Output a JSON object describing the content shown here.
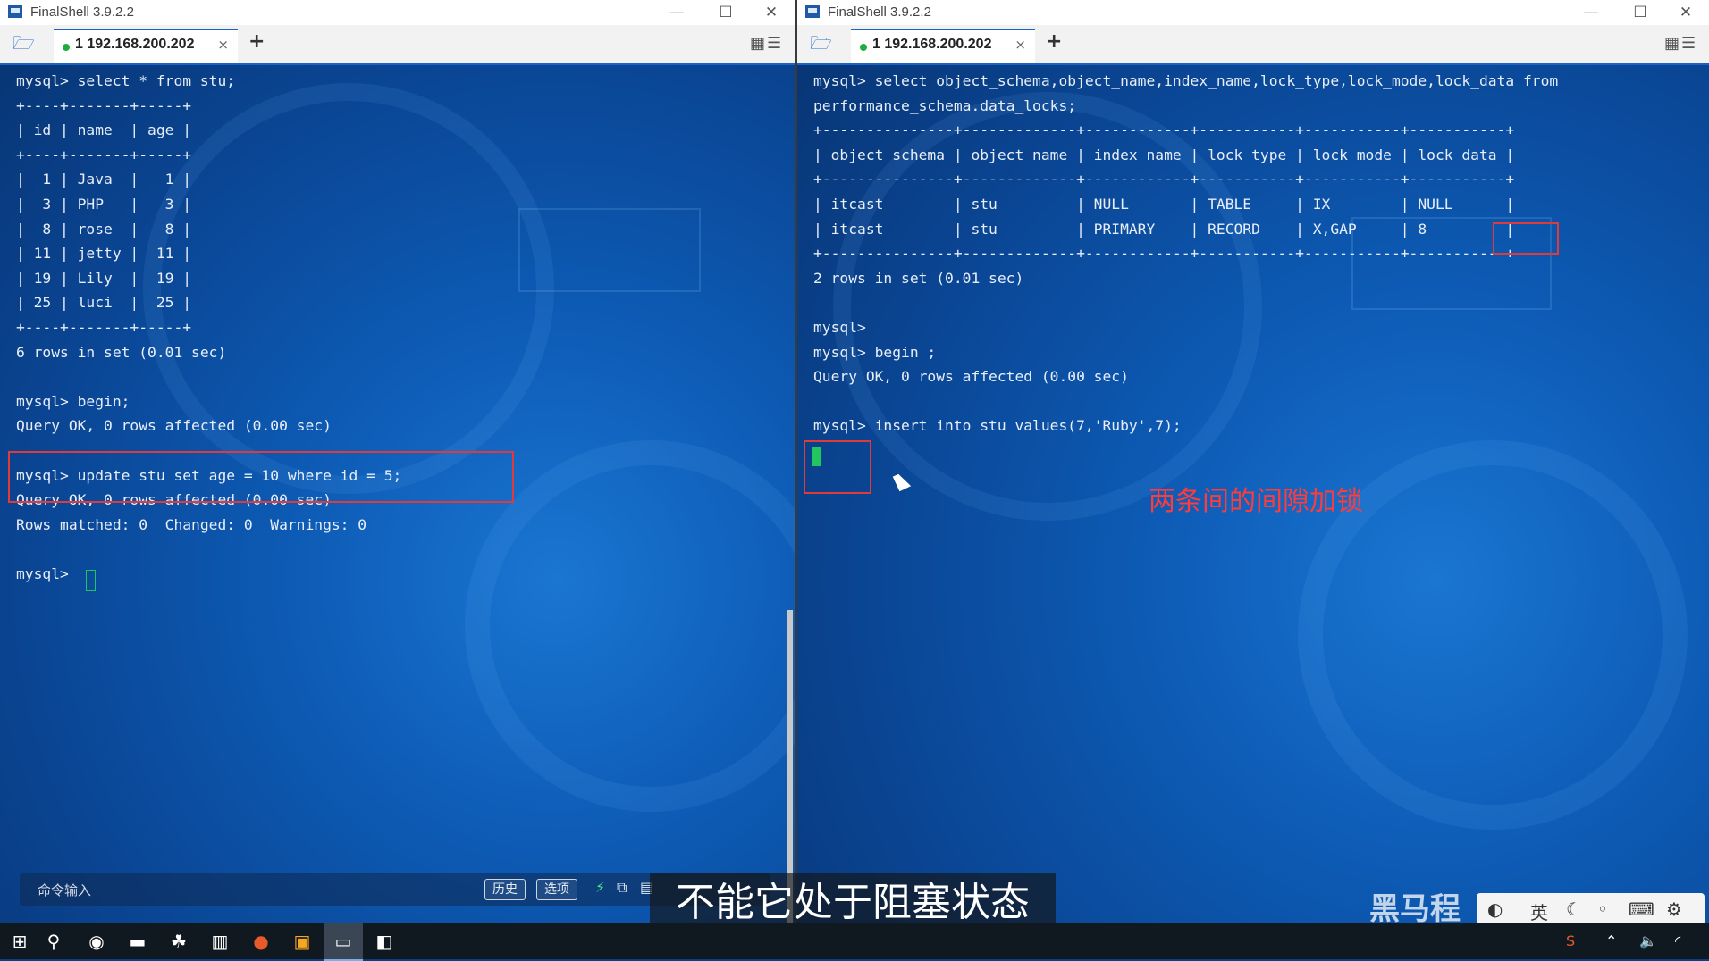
{
  "left": {
    "title": "FinalShell 3.9.2.2",
    "tab_label": "1 192.168.200.202",
    "tab_close": "×",
    "add_tab": "+",
    "terminal_lines": [
      "mysql> select * from stu;",
      "+----+-------+-----+",
      "| id | name  | age |",
      "+----+-------+-----+",
      "|  1 | Java  |   1 |",
      "|  3 | PHP   |   3 |",
      "|  8 | rose  |   8 |",
      "| 11 | jetty |  11 |",
      "| 19 | Lily  |  19 |",
      "| 25 | luci  |  25 |",
      "+----+-------+-----+",
      "6 rows in set (0.01 sec)",
      "",
      "mysql> begin;",
      "Query OK, 0 rows affected (0.00 sec)",
      "",
      "mysql> update stu set age = 10 where id = 5;",
      "Query OK, 0 rows affected (0.00 sec)",
      "Rows matched: 0  Changed: 0  Warnings: 0",
      "",
      "mysql> "
    ],
    "cmd_input_label": "命令输入",
    "history_button": "历史",
    "options_button": "选项"
  },
  "right": {
    "title": "FinalShell 3.9.2.2",
    "tab_label": "1 192.168.200.202",
    "tab_close": "×",
    "add_tab": "+",
    "terminal_lines": [
      "mysql> select object_schema,object_name,index_name,lock_type,lock_mode,lock_data from",
      "performance_schema.data_locks;",
      "+---------------+-------------+------------+-----------+-----------+-----------+",
      "| object_schema | object_name | index_name | lock_type | lock_mode | lock_data |",
      "+---------------+-------------+------------+-----------+-----------+-----------+",
      "| itcast        | stu         | NULL       | TABLE     | IX        | NULL      |",
      "| itcast        | stu         | PRIMARY    | RECORD    | X,GAP     | 8         |",
      "+---------------+-------------+------------+-----------+-----------+-----------+",
      "2 rows in set (0.01 sec)",
      "",
      "mysql>",
      "mysql> begin ;",
      "Query OK, 0 rows affected (0.00 sec)",
      "",
      "mysql> insert into stu values(7,'Ruby',7);"
    ],
    "annotation": "两条间的间隙加锁"
  },
  "subtitle": "不能它处于阻塞状态",
  "watermark": "黑马程",
  "ime": {
    "lang": "英"
  },
  "colors": {
    "accent": "#1c63c4",
    "highlight": "#e03a3a",
    "cursor": "#22c55e"
  }
}
